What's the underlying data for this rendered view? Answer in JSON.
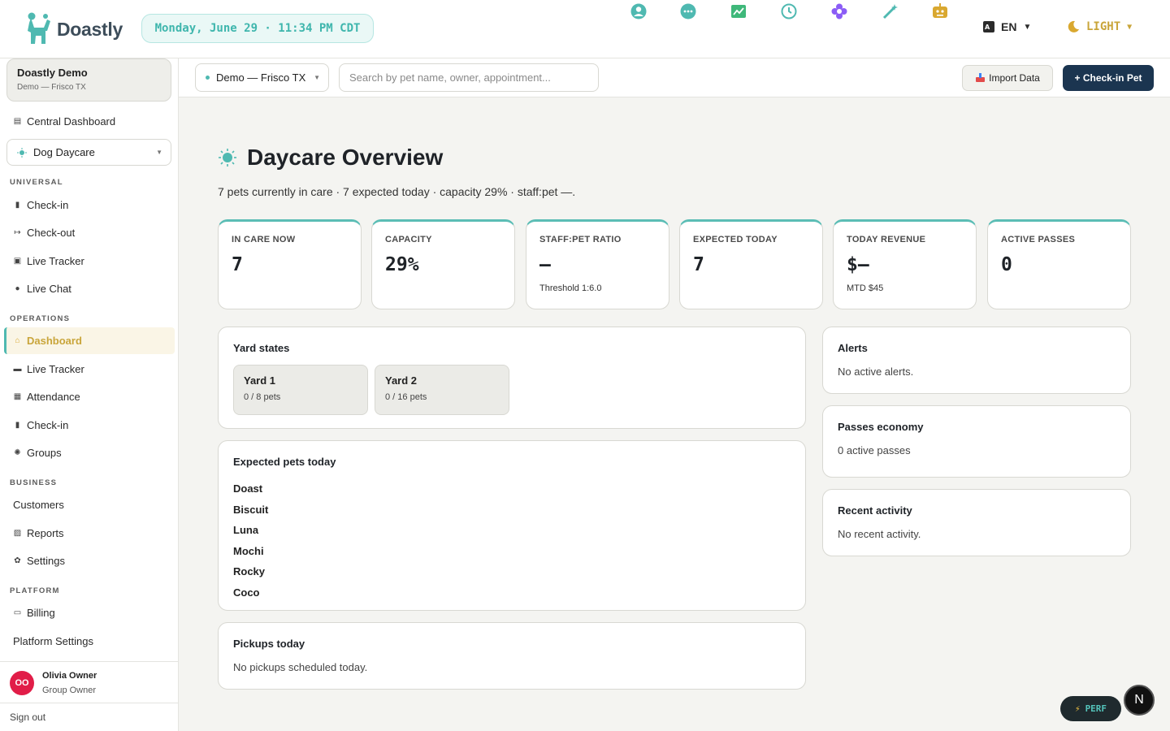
{
  "app": {
    "brand": "Doastly",
    "datetime": "Monday, June 29 · 11:34 PM CDT",
    "language": "EN",
    "theme": "LIGHT",
    "accent_color": "#4fb9b1",
    "top_icons": [
      "user-circle-icon",
      "chat-icon",
      "chart-icon",
      "clock-icon",
      "flower-icon",
      "magic-wand-icon",
      "robot-icon"
    ]
  },
  "sidebar": {
    "org_name": "Doastly Demo",
    "org_location": "Demo — Frisco TX",
    "central_dashboard": "Central Dashboard",
    "module": "Dog Daycare",
    "sections": {
      "universal": "UNIVERSAL",
      "operations": "OPERATIONS",
      "business": "BUSINESS",
      "platform": "PLATFORM"
    },
    "universal_items": [
      "Check-in",
      "Check-out",
      "Live Tracker",
      "Live Chat"
    ],
    "operations_items": [
      "Dashboard",
      "Live Tracker",
      "Attendance",
      "Check-in",
      "Groups"
    ],
    "business_items": [
      "Customers",
      "Reports",
      "Settings"
    ],
    "platform_items": [
      "Billing",
      "Platform Settings"
    ],
    "active_item": "Dashboard",
    "user": {
      "initials": "OO",
      "name": "Olivia Owner",
      "role": "Group Owner"
    },
    "sign_out": "Sign out"
  },
  "toolbar": {
    "location": "Demo — Frisco TX",
    "search_placeholder": "Search by pet name, owner, appointment...",
    "import_label": "Import Data",
    "checkin_label": "+ Check-in Pet"
  },
  "main": {
    "title": "Daycare Overview",
    "subtitle": "7 pets currently in care · 7 expected today · capacity 29% · staff:pet —.",
    "stats": [
      {
        "label": "IN CARE NOW",
        "value": "7",
        "note": ""
      },
      {
        "label": "CAPACITY",
        "value": "29%",
        "note": ""
      },
      {
        "label": "STAFF:PET RATIO",
        "value": "–",
        "note": "Threshold 1:6.0"
      },
      {
        "label": "EXPECTED TODAY",
        "value": "7",
        "note": ""
      },
      {
        "label": "TODAY REVENUE",
        "value": "$–",
        "note": "MTD $45"
      },
      {
        "label": "ACTIVE PASSES",
        "value": "0",
        "note": ""
      }
    ],
    "yard_states": {
      "title": "Yard states",
      "yards": [
        {
          "name": "Yard 1",
          "count": "0 / 8 pets"
        },
        {
          "name": "Yard 2",
          "count": "0 / 16 pets"
        }
      ]
    },
    "expected_pets": {
      "title": "Expected pets today",
      "pets": [
        "Doast",
        "Biscuit",
        "Luna",
        "Mochi",
        "Rocky",
        "Coco"
      ]
    },
    "pickups": {
      "title": "Pickups today",
      "text": "No pickups scheduled today."
    },
    "alerts": {
      "title": "Alerts",
      "text": "No active alerts."
    },
    "passes": {
      "title": "Passes economy",
      "text": "0 active passes"
    },
    "activity": {
      "title": "Recent activity",
      "text": "No recent activity."
    }
  },
  "overlay": {
    "perf_label": "PERF",
    "next_badge": "N"
  }
}
